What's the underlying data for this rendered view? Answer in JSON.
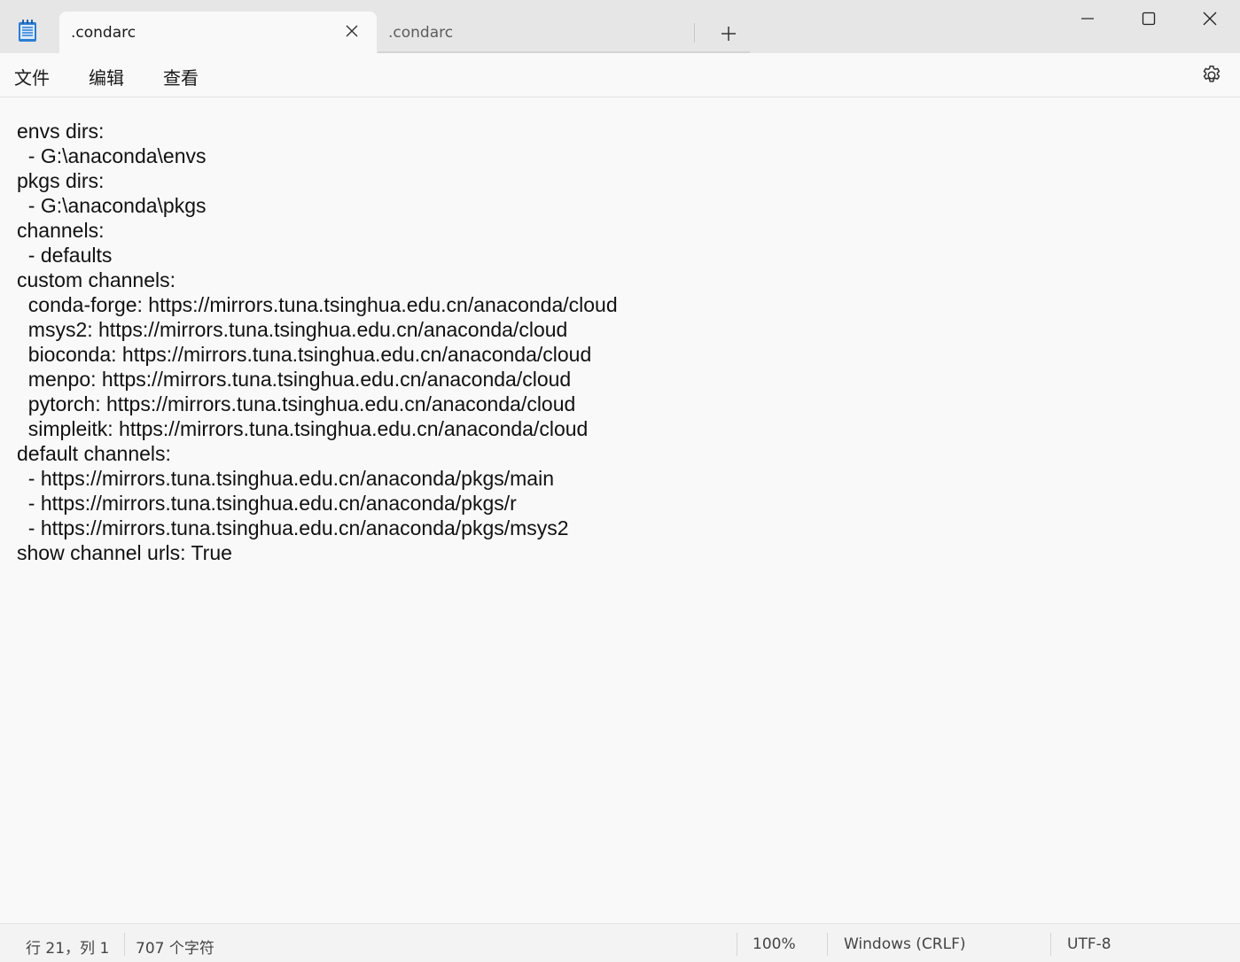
{
  "titlebar": {
    "app_icon": "notepad-icon",
    "tabs": [
      {
        "label": ".condarc",
        "active": true
      },
      {
        "label": ".condarc",
        "active": false
      }
    ],
    "new_tab_icon": "plus-icon",
    "window_controls": [
      "minimize-icon",
      "maximize-icon",
      "close-icon"
    ]
  },
  "menu": {
    "file": "文件",
    "edit": "编辑",
    "view": "查看",
    "settings_icon": "gear-icon"
  },
  "editor": {
    "lines": [
      "envs dirs:",
      "  - G:\\anaconda\\envs",
      "pkgs dirs:",
      "  - G:\\anaconda\\pkgs",
      "channels:",
      "  - defaults",
      "custom channels:",
      "  conda-forge: https://mirrors.tuna.tsinghua.edu.cn/anaconda/cloud",
      "  msys2: https://mirrors.tuna.tsinghua.edu.cn/anaconda/cloud",
      "  bioconda: https://mirrors.tuna.tsinghua.edu.cn/anaconda/cloud",
      "  menpo: https://mirrors.tuna.tsinghua.edu.cn/anaconda/cloud",
      "  pytorch: https://mirrors.tuna.tsinghua.edu.cn/anaconda/cloud",
      "  simpleitk: https://mirrors.tuna.tsinghua.edu.cn/anaconda/cloud",
      "default channels:",
      "  - https://mirrors.tuna.tsinghua.edu.cn/anaconda/pkgs/main",
      "  - https://mirrors.tuna.tsinghua.edu.cn/anaconda/pkgs/r",
      "  - https://mirrors.tuna.tsinghua.edu.cn/anaconda/pkgs/msys2",
      "show channel urls: True"
    ]
  },
  "status": {
    "position": "行 21，列 1",
    "chars": "707 个字符",
    "zoom": "100%",
    "line_ending": "Windows (CRLF)",
    "encoding": "UTF-8"
  },
  "colors": {
    "titlebar_bg": "#e6e6e6",
    "content_bg": "#f9f9f9",
    "statusbar_bg": "#f3f3f3",
    "icon_blue": "#2d7dd2"
  }
}
